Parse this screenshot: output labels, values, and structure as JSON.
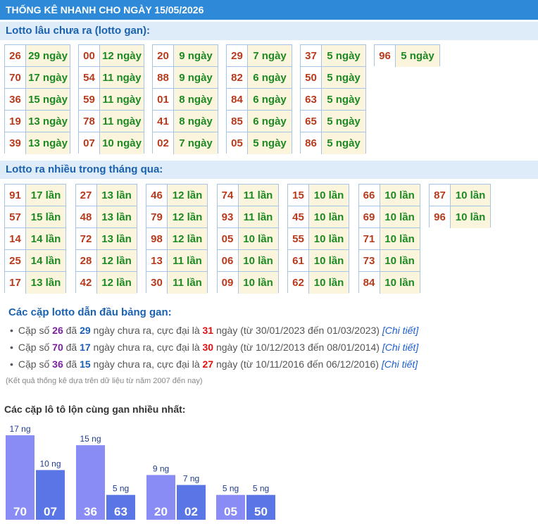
{
  "header": {
    "title": "THỐNG KÊ NHANH CHO NGÀY 15/05/2026"
  },
  "gan": {
    "title": "Lotto lâu chưa ra (lotto gan):",
    "columns": [
      [
        {
          "n": "26",
          "v": "29 ngày"
        },
        {
          "n": "70",
          "v": "17 ngày"
        },
        {
          "n": "36",
          "v": "15 ngày"
        },
        {
          "n": "19",
          "v": "13 ngày"
        },
        {
          "n": "39",
          "v": "13 ngày"
        }
      ],
      [
        {
          "n": "00",
          "v": "12 ngày"
        },
        {
          "n": "54",
          "v": "11 ngày"
        },
        {
          "n": "59",
          "v": "11 ngày"
        },
        {
          "n": "78",
          "v": "11 ngày"
        },
        {
          "n": "07",
          "v": "10 ngày"
        }
      ],
      [
        {
          "n": "20",
          "v": "9 ngày"
        },
        {
          "n": "88",
          "v": "9 ngày"
        },
        {
          "n": "01",
          "v": "8 ngày"
        },
        {
          "n": "41",
          "v": "8 ngày"
        },
        {
          "n": "02",
          "v": "7 ngày"
        }
      ],
      [
        {
          "n": "29",
          "v": "7 ngày"
        },
        {
          "n": "82",
          "v": "6 ngày"
        },
        {
          "n": "84",
          "v": "6 ngày"
        },
        {
          "n": "85",
          "v": "6 ngày"
        },
        {
          "n": "05",
          "v": "5 ngày"
        }
      ],
      [
        {
          "n": "37",
          "v": "5 ngày"
        },
        {
          "n": "50",
          "v": "5 ngày"
        },
        {
          "n": "63",
          "v": "5 ngày"
        },
        {
          "n": "65",
          "v": "5 ngày"
        },
        {
          "n": "86",
          "v": "5 ngày"
        }
      ],
      [
        {
          "n": "96",
          "v": "5 ngày"
        }
      ]
    ]
  },
  "nhieu": {
    "title": "Lotto ra nhiều trong tháng qua:",
    "columns": [
      [
        {
          "n": "91",
          "v": "17 lần"
        },
        {
          "n": "57",
          "v": "15 lần"
        },
        {
          "n": "14",
          "v": "14 lần"
        },
        {
          "n": "25",
          "v": "14 lần"
        },
        {
          "n": "17",
          "v": "13 lần"
        }
      ],
      [
        {
          "n": "27",
          "v": "13 lần"
        },
        {
          "n": "48",
          "v": "13 lần"
        },
        {
          "n": "72",
          "v": "13 lần"
        },
        {
          "n": "28",
          "v": "12 lần"
        },
        {
          "n": "42",
          "v": "12 lần"
        }
      ],
      [
        {
          "n": "46",
          "v": "12 lần"
        },
        {
          "n": "79",
          "v": "12 lần"
        },
        {
          "n": "98",
          "v": "12 lần"
        },
        {
          "n": "13",
          "v": "11 lần"
        },
        {
          "n": "30",
          "v": "11 lần"
        }
      ],
      [
        {
          "n": "74",
          "v": "11 lần"
        },
        {
          "n": "93",
          "v": "11 lần"
        },
        {
          "n": "05",
          "v": "10 lần"
        },
        {
          "n": "06",
          "v": "10 lần"
        },
        {
          "n": "09",
          "v": "10 lần"
        }
      ],
      [
        {
          "n": "15",
          "v": "10 lần"
        },
        {
          "n": "45",
          "v": "10 lần"
        },
        {
          "n": "55",
          "v": "10 lần"
        },
        {
          "n": "61",
          "v": "10 lần"
        },
        {
          "n": "62",
          "v": "10 lần"
        }
      ],
      [
        {
          "n": "66",
          "v": "10 lần"
        },
        {
          "n": "69",
          "v": "10 lần"
        },
        {
          "n": "71",
          "v": "10 lần"
        },
        {
          "n": "73",
          "v": "10 lần"
        },
        {
          "n": "84",
          "v": "10 lần"
        }
      ],
      [
        {
          "n": "87",
          "v": "10 lần"
        },
        {
          "n": "96",
          "v": "10 lần"
        }
      ]
    ]
  },
  "pairs": {
    "title": "Các cặp lotto dẫn đầu bảng gan:",
    "items": [
      {
        "pre": "Cặp số ",
        "num": "26",
        "mid1": " đã ",
        "days": "29",
        "mid2": " ngày chưa ra, cực đại là ",
        "max": "31",
        "mid3": " ngày (từ 30/01/2023 đến 01/03/2023) ",
        "link": "[Chi tiết]"
      },
      {
        "pre": "Cặp số ",
        "num": "70",
        "mid1": " đã ",
        "days": "17",
        "mid2": " ngày chưa ra, cực đại là ",
        "max": "30",
        "mid3": " ngày (từ 10/12/2013 đến 08/01/2014) ",
        "link": "[Chi tiết]"
      },
      {
        "pre": "Cặp số ",
        "num": "36",
        "mid1": " đã ",
        "days": "15",
        "mid2": " ngày chưa ra, cực đại là ",
        "max": "27",
        "mid3": " ngày (từ 10/11/2016 đến 06/12/2016) ",
        "link": "[Chi tiết]"
      }
    ]
  },
  "note": "(Kết quả thống kê dựa trên dữ liệu từ năm 2007 đến nay)",
  "chart_data": {
    "type": "bar",
    "title": "Các cặp lô tô lộn cùng gan nhiều nhất:",
    "categories": [
      "70",
      "07",
      "36",
      "63",
      "20",
      "02",
      "05",
      "50"
    ],
    "values": [
      17,
      10,
      15,
      5,
      9,
      7,
      5,
      5
    ],
    "value_labels": [
      "17 ng",
      "10 ng",
      "15 ng",
      "5 ng",
      "9 ng",
      "7 ng",
      "5 ng",
      "5 ng"
    ],
    "ylim": [
      0,
      17
    ],
    "colors": {
      "first": "#8a8cf6",
      "second": "#5a75e6",
      "label": "#1f3c8c"
    }
  }
}
